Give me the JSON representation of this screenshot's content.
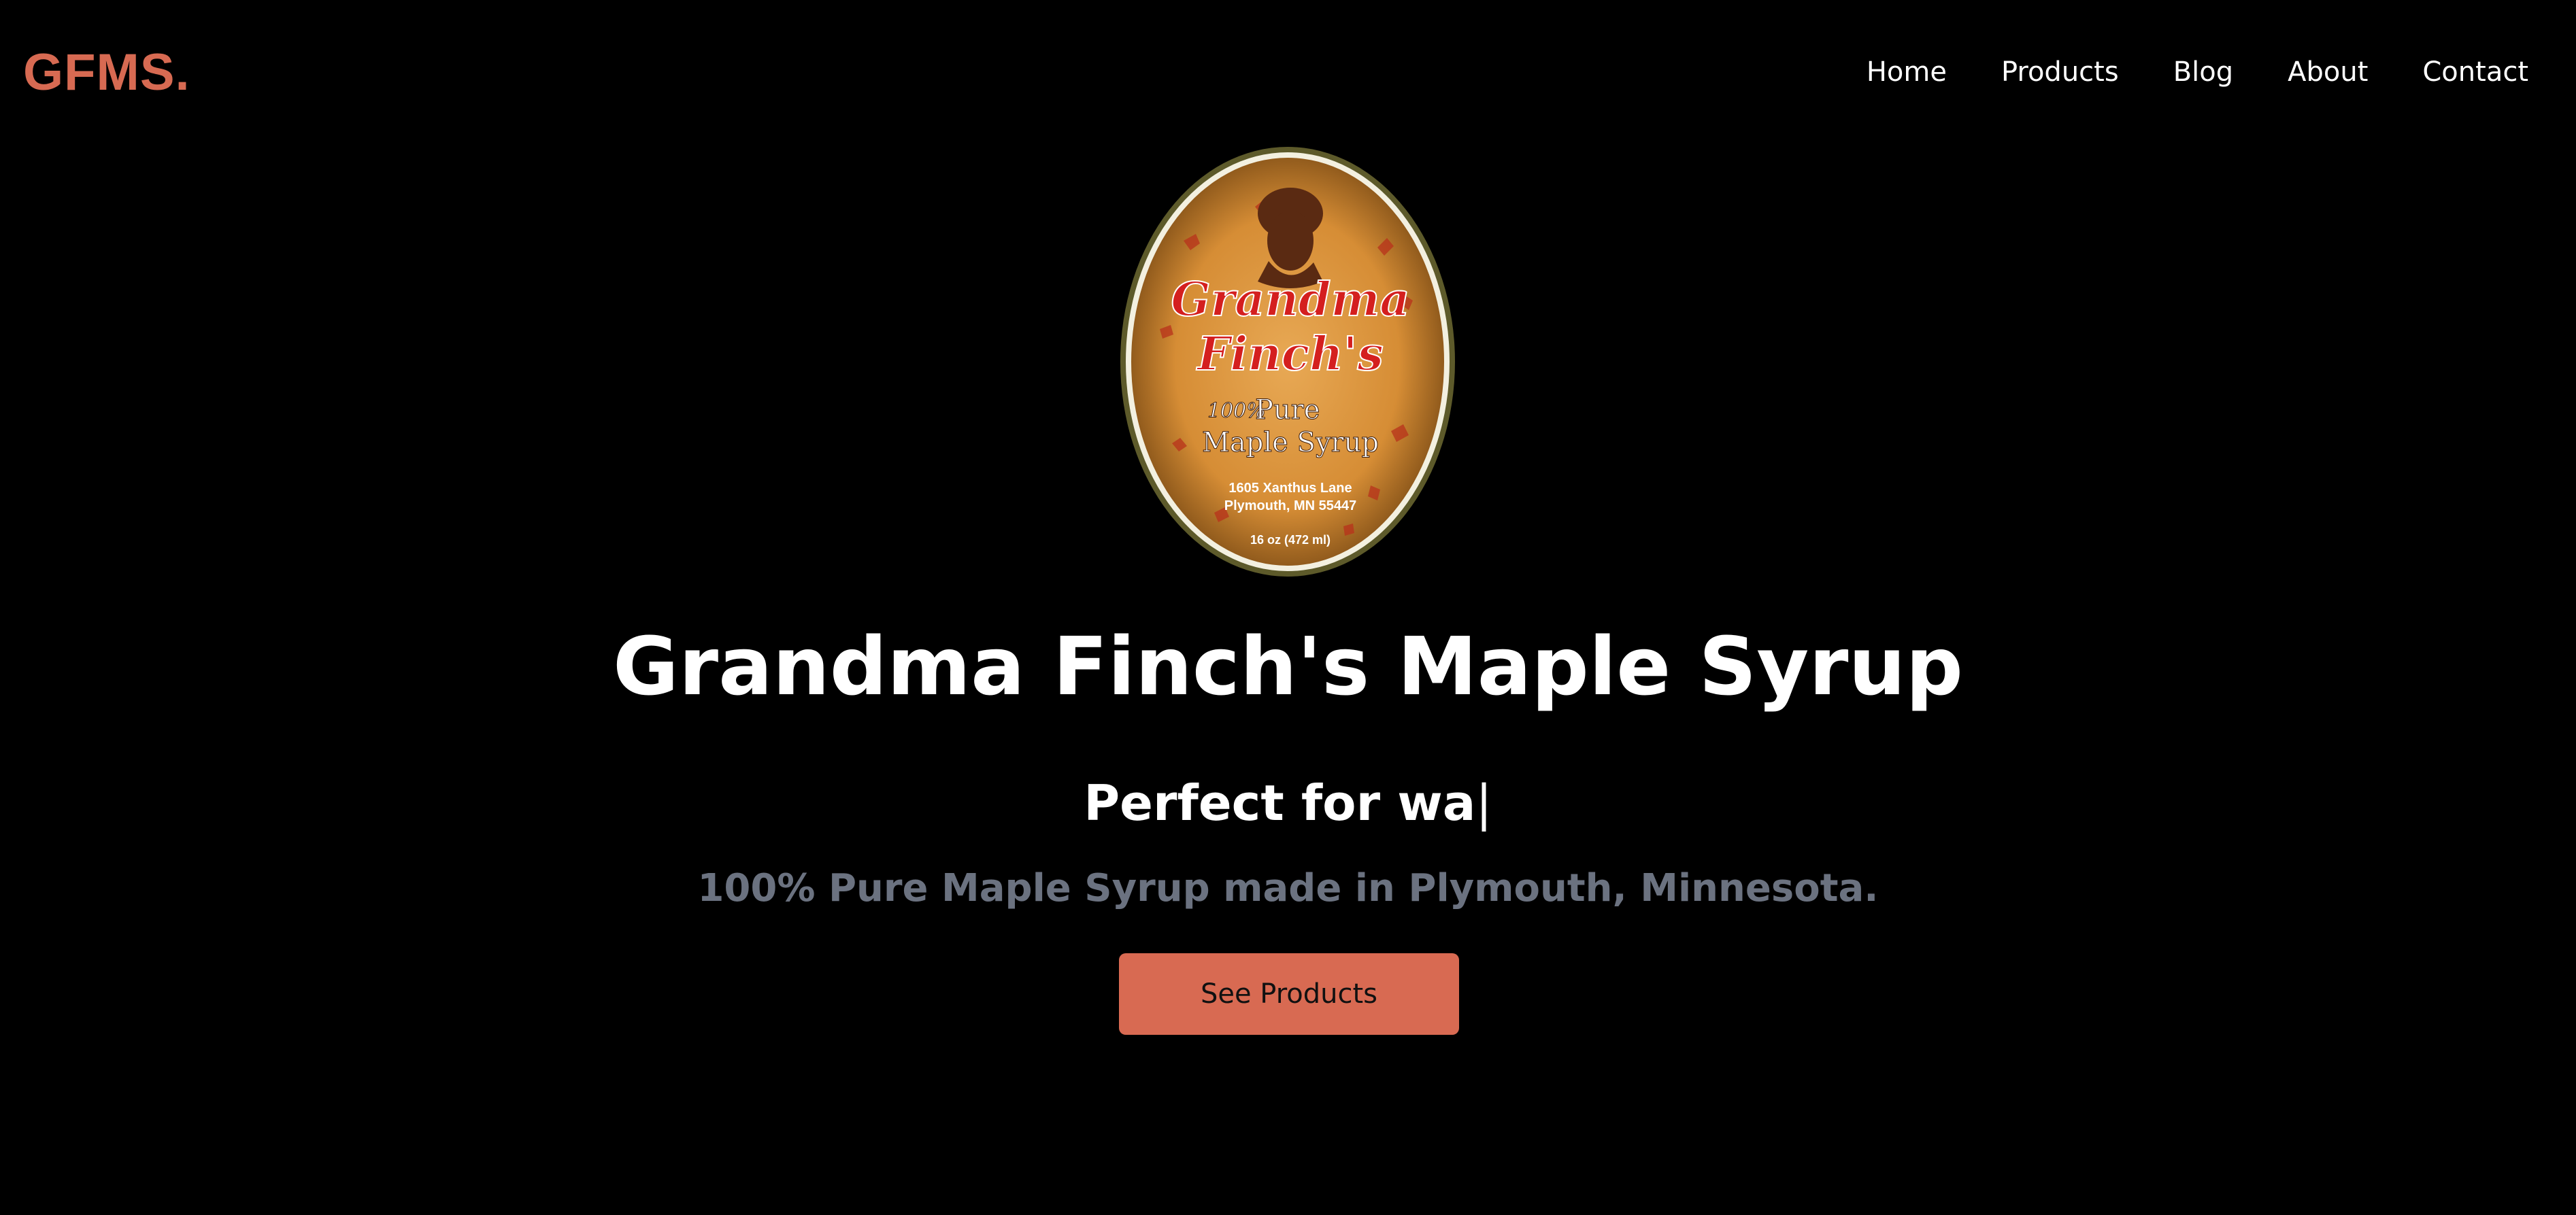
{
  "brand": {
    "logo_text": "GFMS.",
    "accent_color": "#d76a52"
  },
  "nav": {
    "items": [
      {
        "label": "Home"
      },
      {
        "label": "Products"
      },
      {
        "label": "Blog"
      },
      {
        "label": "About"
      },
      {
        "label": "Contact"
      }
    ]
  },
  "product_label": {
    "brand_line1": "Grandma",
    "brand_line2": "Finch's",
    "purity": "100%",
    "pure": "Pure",
    "product": "Maple Syrup",
    "address_line1": "1605 Xanthus Lane",
    "address_line2": "Plymouth, MN 55447",
    "volume": "16 oz (472 ml)"
  },
  "hero": {
    "title": "Grandma Finch's Maple Syrup",
    "subtitle_prefix": "Perfect for ",
    "typed_text": " wa",
    "cursor": "|",
    "description": "100% Pure Maple Syrup made in Plymouth, Minnesota.",
    "cta_label": "See Products"
  }
}
